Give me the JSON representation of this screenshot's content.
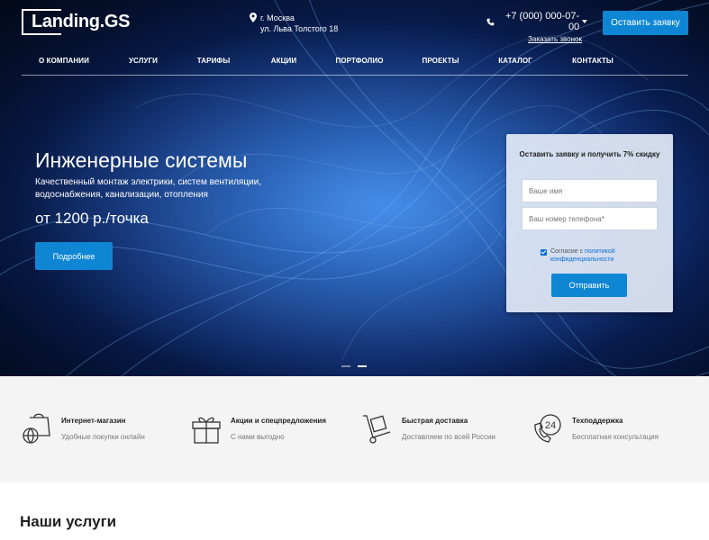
{
  "header": {
    "logo": "Landing.GS",
    "address": {
      "city": "г. Москва",
      "street": "ул. Льва Толстого 18"
    },
    "phone": "+7 (000) 000-07-00",
    "callback_label": "Заказать звонок",
    "cta_label": "Оставить заявку"
  },
  "nav": {
    "items": [
      {
        "label": "О КОМПАНИИ"
      },
      {
        "label": "УСЛУГИ"
      },
      {
        "label": "ТАРИФЫ"
      },
      {
        "label": "АКЦИИ"
      },
      {
        "label": "ПОРТФОЛИО"
      },
      {
        "label": "ПРОЕКТЫ"
      },
      {
        "label": "КАТАЛОГ"
      },
      {
        "label": "КОНТАКТЫ"
      }
    ]
  },
  "hero": {
    "title": "Инженерные системы",
    "subtitle": "Качественный монтаж электрики, систем вентиляции, водоснабжения, канализации, отопления",
    "price": "от 1200 р./точка",
    "more_label": "Подробнее",
    "slides_count": 2,
    "active_slide": 2
  },
  "form": {
    "title": "Оставить заявку и получить 7% скидку",
    "name_placeholder": "Ваше имя",
    "phone_placeholder": "Ваш номер телефона*",
    "consent_text": "Согласие с ",
    "consent_link": "политикой конфиденциальности",
    "consent_checked": true,
    "submit_label": "Отправить"
  },
  "features": {
    "items": [
      {
        "icon": "shopping-bag-globe-icon",
        "title": "Интернет-магазин",
        "desc": "Удобные покупки онлайн"
      },
      {
        "icon": "gift-box-icon",
        "title": "Акции и спецпредложения",
        "desc": "С нами выгодно"
      },
      {
        "icon": "hand-truck-icon",
        "title": "Быстрая доставка",
        "desc": "Доставляем по всей России"
      },
      {
        "icon": "support-24-phone-icon",
        "title": "Техподдержка",
        "desc": "Бесплатная консультация"
      }
    ]
  },
  "services": {
    "title": "Наши услуги"
  },
  "colors": {
    "accent": "#0e86d4",
    "hero_dark": "#04112f",
    "features_bg": "#f4f4f4"
  }
}
